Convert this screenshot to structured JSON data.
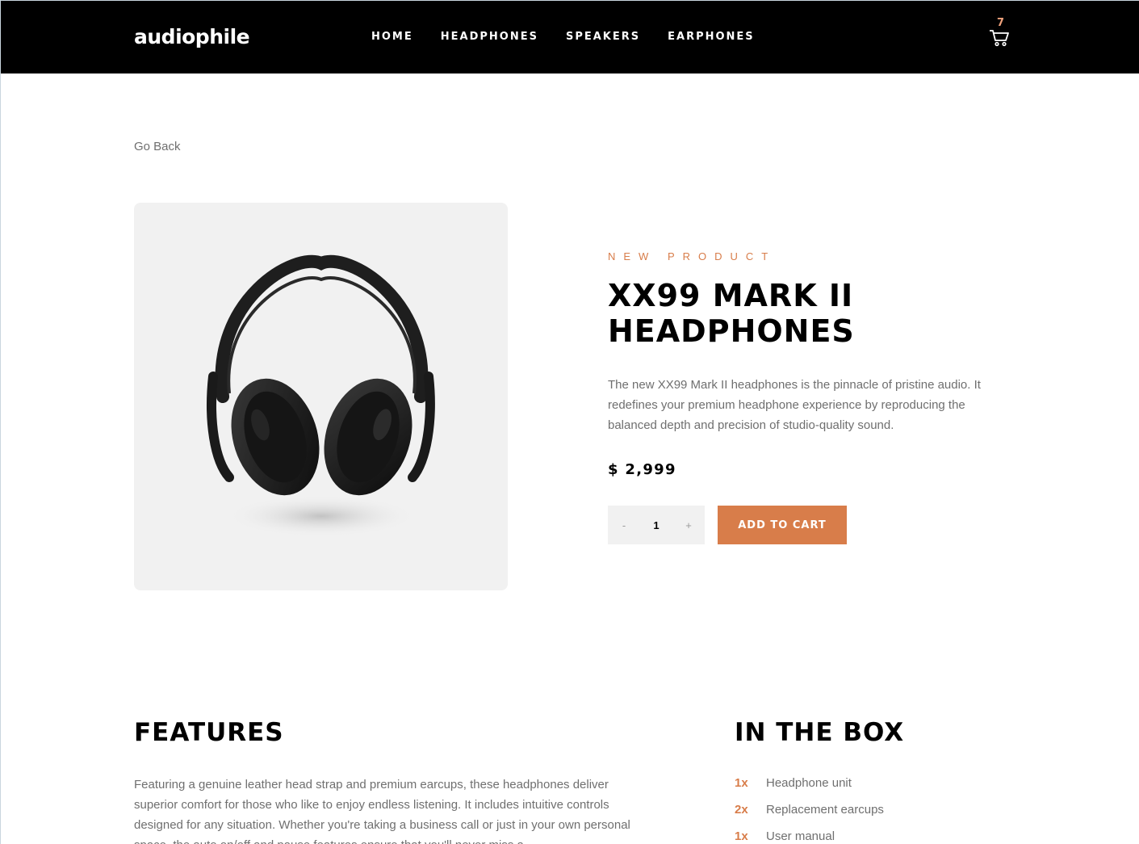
{
  "header": {
    "logo": "audiophile",
    "nav": [
      {
        "label": "HOME"
      },
      {
        "label": "HEADPHONES"
      },
      {
        "label": "SPEAKERS"
      },
      {
        "label": "EARPHONES"
      }
    ],
    "cart_count": "7",
    "cart_icon": "shopping-cart-icon"
  },
  "go_back": "Go Back",
  "product": {
    "eyebrow": "NEW PRODUCT",
    "title": "XX99 MARK II HEADPHONES",
    "description": "The new XX99 Mark II headphones is the pinnacle of pristine audio. It redefines your premium headphone experience by reproducing the balanced depth and precision of studio-quality sound.",
    "price": "$ 2,999",
    "quantity": {
      "minus": "-",
      "value": "1",
      "plus": "+"
    },
    "add_to_cart": "ADD TO CART",
    "image_icon": "headphones-image"
  },
  "features": {
    "heading": "FEATURES",
    "text": "Featuring a genuine leather head strap and premium earcups, these headphones deliver superior comfort for those who like to enjoy endless listening. It includes intuitive controls designed for any situation. Whether you're taking a business call or just in your own personal space, the auto on/off and pause features ensure that you'll never miss a"
  },
  "in_the_box": {
    "heading": "IN THE BOX",
    "items": [
      {
        "qty": "1x",
        "name": "Headphone unit"
      },
      {
        "qty": "2x",
        "name": "Replacement earcups"
      },
      {
        "qty": "1x",
        "name": "User manual"
      }
    ]
  },
  "colors": {
    "accent": "#d87d4a",
    "header_bg": "#000000",
    "panel_bg": "#f1f1f1",
    "muted_text": "#6f6f6f"
  }
}
